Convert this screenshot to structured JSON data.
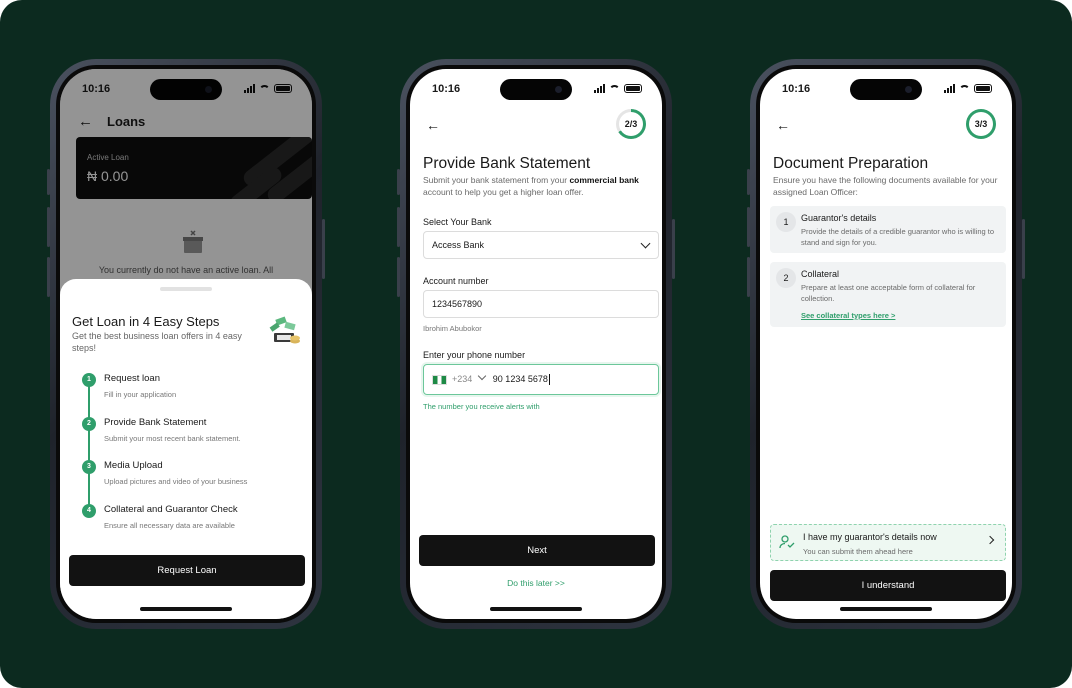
{
  "status": {
    "time": "10:16"
  },
  "screen1": {
    "nav_title": "Loans",
    "active_loan_label": "Active Loan",
    "active_loan_amount": "₦ 0.00",
    "empty_text": "You currently do not have an active loan. All",
    "sheet_title": "Get Loan in 4 Easy Steps",
    "sheet_subtitle": "Get the best business loan offers in 4 easy steps!",
    "steps": [
      {
        "num": "1",
        "title": "Request loan",
        "desc": "Fill in your application"
      },
      {
        "num": "2",
        "title": "Provide Bank Statement",
        "desc": "Submit your most recent bank statement."
      },
      {
        "num": "3",
        "title": "Media Upload",
        "desc": "Upload pictures and video of your business"
      },
      {
        "num": "4",
        "title": "Collateral and Guarantor Check",
        "desc": "Ensure all necessary data are available"
      }
    ],
    "button_label": "Request Loan"
  },
  "screen2": {
    "progress": "2/3",
    "progress_fraction": 0.66,
    "title": "Provide Bank Statement",
    "desc_prefix": "Submit your bank statement from your ",
    "desc_bold": "commercial bank",
    "desc_suffix": " account to help you get a higher loan offer.",
    "bank_label": "Select Your Bank",
    "bank_value": "Access Bank",
    "account_label": "Account number",
    "account_value": "1234567890",
    "account_name": "Ibrohim Abubokor",
    "phone_label": "Enter your phone number",
    "country_code": "+234",
    "phone_value": "90 1234 5678",
    "phone_hint": "The number you receive alerts with",
    "next_label": "Next",
    "later_label": "Do this later >>"
  },
  "screen3": {
    "progress": "3/3",
    "progress_fraction": 1.0,
    "title": "Document Preparation",
    "desc": "Ensure you have the following documents available for your assigned Loan Officer:",
    "items": [
      {
        "num": "1",
        "title": "Guarantor's details",
        "desc": "Provide the details of a credible guarantor who is willing to stand and sign for you."
      },
      {
        "num": "2",
        "title": "Collateral",
        "desc": "Prepare at least one acceptable form of collateral for collection.",
        "link": "See collateral types here >"
      }
    ],
    "notice_title": "I have my guarantor's details now",
    "notice_sub": "You can submit them ahead here",
    "button_label": "I understand"
  },
  "colors": {
    "background": "#0c2a1f",
    "accent": "#2f9e6b",
    "button": "#121212"
  }
}
